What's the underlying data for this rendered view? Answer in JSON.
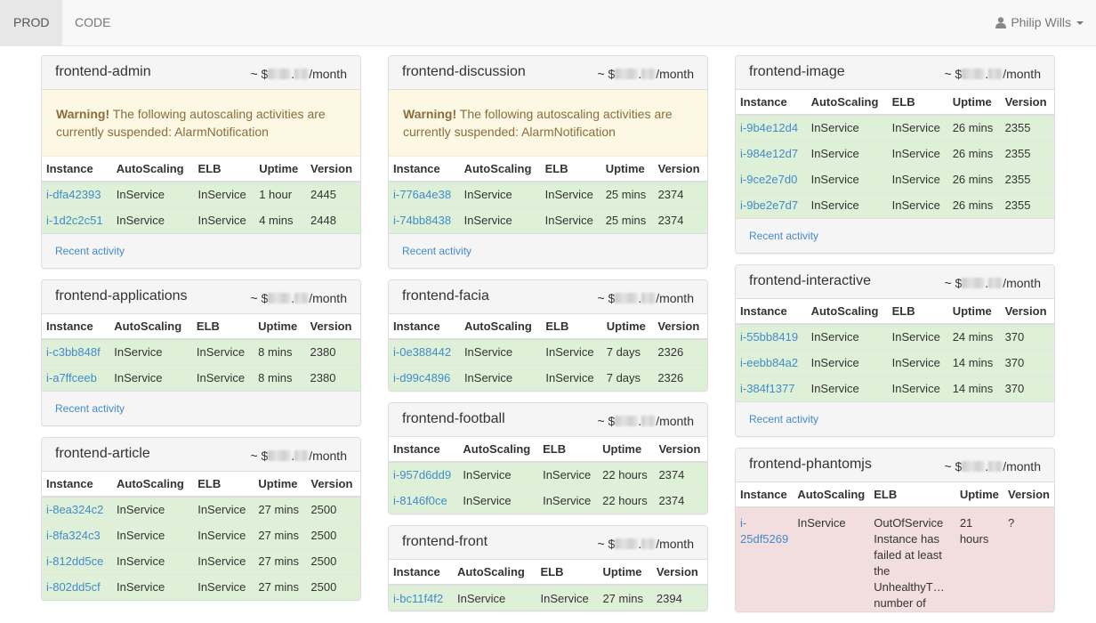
{
  "nav": {
    "tabs": [
      "PROD",
      "CODE"
    ],
    "user": "Philip Wills"
  },
  "columns": {
    "instance": "Instance",
    "autoscaling": "AutoScaling",
    "elb": "ELB",
    "uptime": "Uptime",
    "version": "Version"
  },
  "cost": {
    "prefix": "~ $",
    "dot": ".",
    "suffix": "/month"
  },
  "recent_activity": "Recent activity",
  "warning": {
    "strong": "Warning!",
    "text": " The following autoscaling activities are currently suspended: AlarmNotification"
  },
  "panels": [
    {
      "title": "frontend-admin",
      "warning": true,
      "footer": true,
      "rows": [
        [
          "i-dfa42393",
          "InService",
          "InService",
          "1 hour",
          "2445"
        ],
        [
          "i-1d2c2c51",
          "InService",
          "InService",
          "4 mins",
          "2448"
        ]
      ]
    },
    {
      "title": "frontend-applications",
      "warning": false,
      "footer": true,
      "rows": [
        [
          "i-c3bb848f",
          "InService",
          "InService",
          "8 mins",
          "2380"
        ],
        [
          "i-a7ffceeb",
          "InService",
          "InService",
          "8 mins",
          "2380"
        ]
      ]
    },
    {
      "title": "frontend-article",
      "warning": false,
      "footer": false,
      "rows": [
        [
          "i-8ea324c2",
          "InService",
          "InService",
          "27 mins",
          "2500"
        ],
        [
          "i-8fa324c3",
          "InService",
          "InService",
          "27 mins",
          "2500"
        ],
        [
          "i-812dd5ce",
          "InService",
          "InService",
          "27 mins",
          "2500"
        ],
        [
          "i-802dd5cf",
          "InService",
          "InService",
          "27 mins",
          "2500"
        ]
      ]
    },
    {
      "title": "frontend-discussion",
      "warning": true,
      "footer": true,
      "rows": [
        [
          "i-776a4e38",
          "InService",
          "InService",
          "25 mins",
          "2374"
        ],
        [
          "i-74bb8438",
          "InService",
          "InService",
          "25 mins",
          "2374"
        ]
      ]
    },
    {
      "title": "frontend-facia",
      "warning": false,
      "footer": false,
      "rows": [
        [
          "i-0e388442",
          "InService",
          "InService",
          "7 days",
          "2326"
        ],
        [
          "i-d99c4896",
          "InService",
          "InService",
          "7 days",
          "2326"
        ]
      ]
    },
    {
      "title": "frontend-football",
      "warning": false,
      "footer": false,
      "rows": [
        [
          "i-957d6dd9",
          "InService",
          "InService",
          "22 hours",
          "2374"
        ],
        [
          "i-8146f0ce",
          "InService",
          "InService",
          "22 hours",
          "2374"
        ]
      ]
    },
    {
      "title": "frontend-front",
      "warning": false,
      "footer": false,
      "rows": [
        [
          "i-bc11f4f2",
          "InService",
          "InService",
          "27 mins",
          "2394"
        ]
      ]
    },
    {
      "title": "frontend-image",
      "warning": false,
      "footer": true,
      "rows": [
        [
          "i-9b4e12d4",
          "InService",
          "InService",
          "26 mins",
          "2355"
        ],
        [
          "i-984e12d7",
          "InService",
          "InService",
          "26 mins",
          "2355"
        ],
        [
          "i-9ce2e7d0",
          "InService",
          "InService",
          "26 mins",
          "2355"
        ],
        [
          "i-9be2e7d7",
          "InService",
          "InService",
          "26 mins",
          "2355"
        ]
      ]
    },
    {
      "title": "frontend-interactive",
      "warning": false,
      "footer": true,
      "rows": [
        [
          "i-55bb8419",
          "InService",
          "InService",
          "24 mins",
          "370"
        ],
        [
          "i-eebb84a2",
          "InService",
          "InService",
          "14 mins",
          "370"
        ],
        [
          "i-384f1377",
          "InService",
          "InService",
          "14 mins",
          "370"
        ]
      ]
    },
    {
      "title": "frontend-phantomjs",
      "warning": false,
      "footer": false,
      "rows": [
        [
          "i-25df5269",
          "InService",
          "OutOfService Instance has failed at least the UnhealthyT… number of",
          "21 hours",
          "?"
        ]
      ]
    }
  ],
  "column_layout": [
    [
      0,
      1,
      2
    ],
    [
      3,
      4,
      5,
      6
    ],
    [
      7,
      8,
      9
    ]
  ]
}
